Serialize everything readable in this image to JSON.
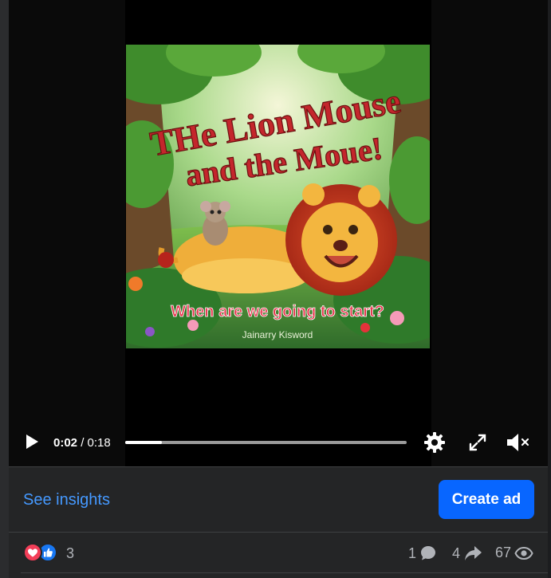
{
  "video": {
    "title_line1": "THe Lion Mouse",
    "title_line2": "and the Moue!",
    "subtitle": "When are we going to start?",
    "author": "Jainarry Kisword",
    "current_time": "0:02",
    "separator": "/",
    "duration": "0:18",
    "progress_fraction": 0.13,
    "icons": [
      "play-icon",
      "settings-gear-icon",
      "fullscreen-icon",
      "volume-muted-icon"
    ]
  },
  "actions": {
    "insights_label": "See insights",
    "create_ad_label": "Create ad"
  },
  "stats": {
    "reaction_count": "3",
    "comments": "1",
    "shares": "4",
    "views": "67",
    "icons": [
      "love-reaction-icon",
      "like-reaction-icon",
      "comment-icon",
      "share-icon",
      "views-eye-icon"
    ]
  },
  "colors": {
    "accent_link": "#4599ff",
    "primary_button": "#0866ff",
    "love": "#f33e58",
    "like": "#1877f2"
  }
}
